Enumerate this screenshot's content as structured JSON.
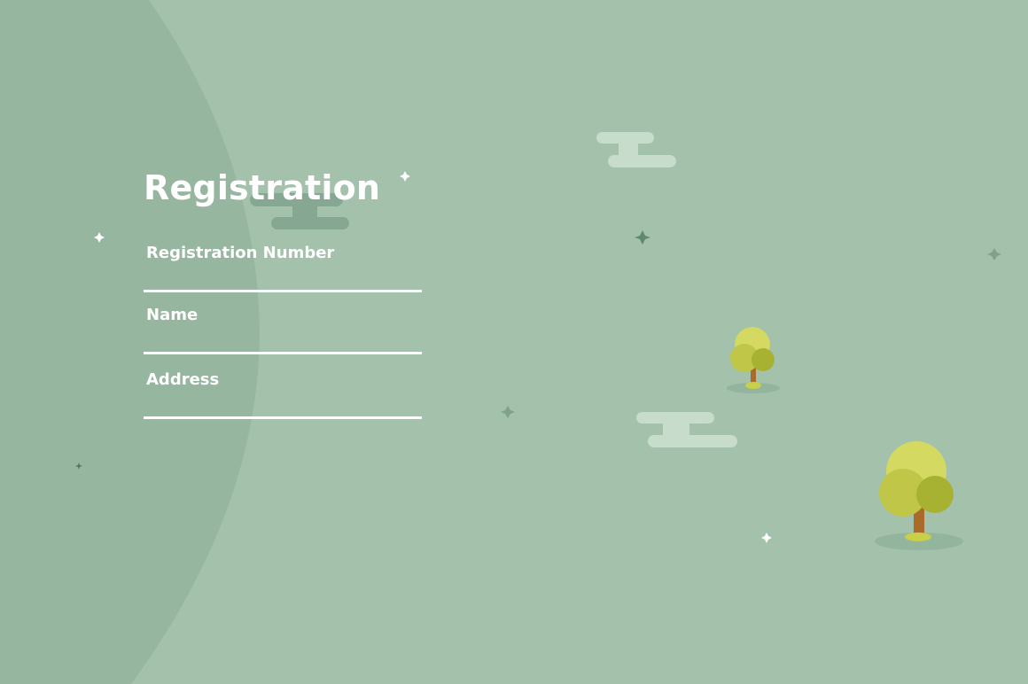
{
  "form": {
    "title": "Registration",
    "fields": [
      {
        "label": "Registration Number",
        "value": ""
      },
      {
        "label": "Name",
        "value": ""
      },
      {
        "label": "Address",
        "value": ""
      }
    ]
  },
  "colors": {
    "background": "#a3c1ab",
    "panel_arc": "#97b6a0",
    "text": "#ffffff",
    "cloud_light": "#c7dccb",
    "cloud_dark": "#86a892",
    "tree_canopy": [
      "#d4d962",
      "#bfc648",
      "#a8b232"
    ],
    "tree_trunk": "#a96a2a",
    "star_light": "#ffffff",
    "star_dark": "#5f8a6d"
  },
  "decorations": {
    "icons": [
      "cloud-icon",
      "tree-icon",
      "sparkle-icon"
    ]
  }
}
